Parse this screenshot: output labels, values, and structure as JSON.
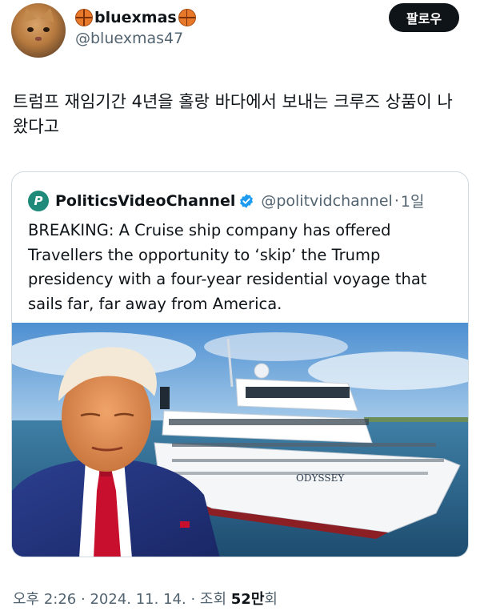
{
  "author": {
    "display_name": "bluexmas",
    "handle": "@bluexmas47",
    "avatar_icon": "cat-avatar",
    "name_emoji_icon": "basketball-icon"
  },
  "follow_button": {
    "label": "팔로우"
  },
  "tweet": {
    "text": "트럼프 재임기간 4년을 홀랑 바다에서 보내는 크루즈 상품이 나왔다고"
  },
  "quote": {
    "avatar_letter": "P",
    "name": "PoliticsVideoChannel",
    "handle": "@politvidchannel",
    "separator": "·",
    "time": "1일",
    "text": "BREAKING: A Cruise ship company has offered Travellers the opportunity to ‘skip’ the Trump presidency with a four-year residential voyage that sails far, far away from America.",
    "image": {
      "ship_name": "ODYSSEY"
    }
  },
  "footer": {
    "time": "오후 2:26",
    "dot1": "·",
    "date": "2024. 11. 14.",
    "dot2": "·",
    "views_label_prefix": "조회",
    "views_count": "52만",
    "views_label_suffix": "회"
  },
  "colors": {
    "text_primary": "#0f1419",
    "text_secondary": "#536471",
    "verified_blue": "#1d9bf0",
    "border": "#cfd9de"
  }
}
